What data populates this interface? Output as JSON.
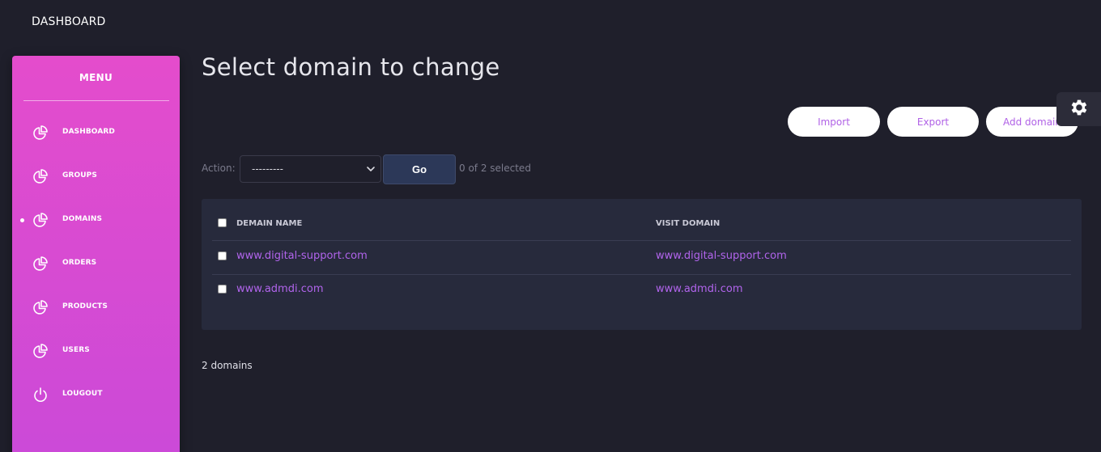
{
  "header": {
    "title": "DASHBOARD"
  },
  "sidebar": {
    "title": "MENU",
    "items": [
      {
        "label": "DASHBOARD",
        "icon": "pie-chart-icon"
      },
      {
        "label": "GROUPS",
        "icon": "pie-chart-icon"
      },
      {
        "label": "DOMAINS",
        "icon": "pie-chart-icon",
        "active": true
      },
      {
        "label": "ORDERS",
        "icon": "pie-chart-icon"
      },
      {
        "label": "PRODUCTS",
        "icon": "pie-chart-icon"
      },
      {
        "label": "USERS",
        "icon": "pie-chart-icon"
      },
      {
        "label": "LOUGOUT",
        "icon": "power-icon"
      }
    ]
  },
  "main": {
    "title": "Select domain to change",
    "buttons": {
      "import": "Import",
      "export": "Export",
      "add": "Add domain"
    },
    "action": {
      "label": "Action:",
      "selected_option": "---------",
      "go_label": "Go",
      "selection_status": "0 of 2 selected"
    },
    "table": {
      "columns": [
        "DEMAIN NAME",
        "VISIT DOMAIN"
      ],
      "rows": [
        {
          "name": "www.digital-support.com",
          "visit": "www.digital-support.com"
        },
        {
          "name": "www.admdi.com",
          "visit": "www.admdi.com"
        }
      ]
    },
    "footer_count": "2 domains"
  },
  "colors": {
    "background": "#1f1f2b",
    "sidebar_top": "#e44ccc",
    "sidebar_bottom": "#cb4ad8",
    "link": "#b164ec",
    "table_bg": "#272a3c"
  }
}
